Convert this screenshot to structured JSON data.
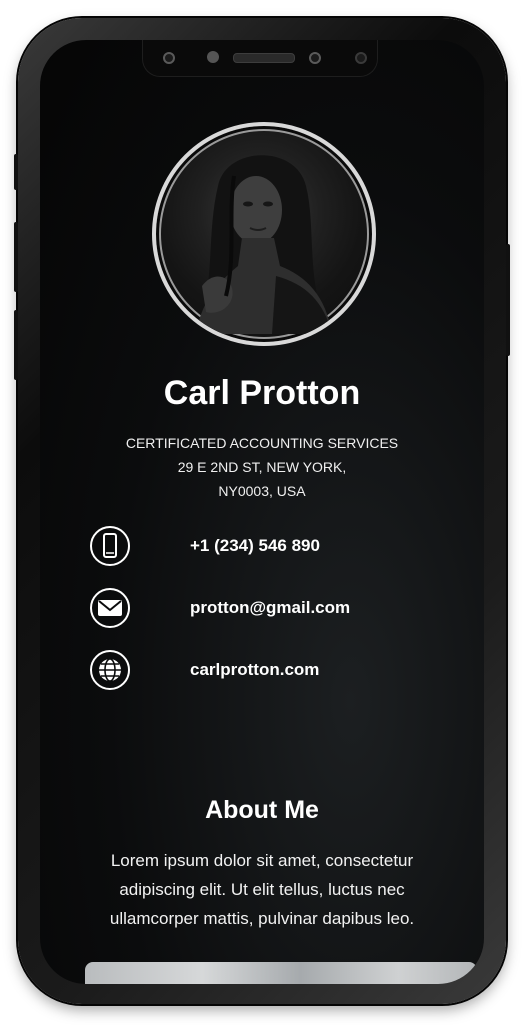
{
  "profile": {
    "name": "Carl Protton",
    "address_line1": "CERTIFICATED ACCOUNTING SERVICES",
    "address_line2": "29 E 2ND ST, NEW YORK,",
    "address_line3": "NY0003, USA"
  },
  "contacts": [
    {
      "icon": "phone-icon",
      "text": "+1 (234) 546 890"
    },
    {
      "icon": "mail-icon",
      "text": "protton@gmail.com"
    },
    {
      "icon": "globe-icon",
      "text": "carlprotton.com"
    }
  ],
  "about": {
    "title": "About Me",
    "text": "Lorem ipsum dolor sit amet, consectetur adipiscing elit. Ut elit tellus, luctus nec ullamcorper mattis, pulvinar dapibus leo."
  },
  "colors": {
    "background": "#0b0c0d",
    "text": "#ffffff",
    "avatar_border": "#d9d9d9"
  }
}
